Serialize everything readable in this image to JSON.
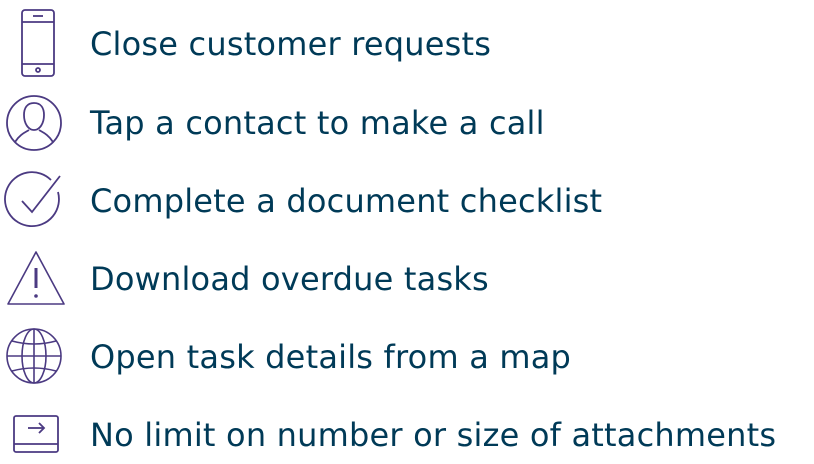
{
  "colors": {
    "icon": "#4b3a82",
    "text": "#003a57",
    "background": "#ffffff"
  },
  "features": [
    {
      "icon": "smartphone-icon",
      "label": "Close customer requests"
    },
    {
      "icon": "user-icon",
      "label": "Tap a contact to make a call"
    },
    {
      "icon": "check-circle-icon",
      "label": "Complete a document checklist"
    },
    {
      "icon": "warning-icon",
      "label": "Download overdue tasks"
    },
    {
      "icon": "globe-icon",
      "label": "Open task details from a map"
    },
    {
      "icon": "attachment-arrow-icon",
      "label": "No limit on number or size of attachments"
    }
  ]
}
